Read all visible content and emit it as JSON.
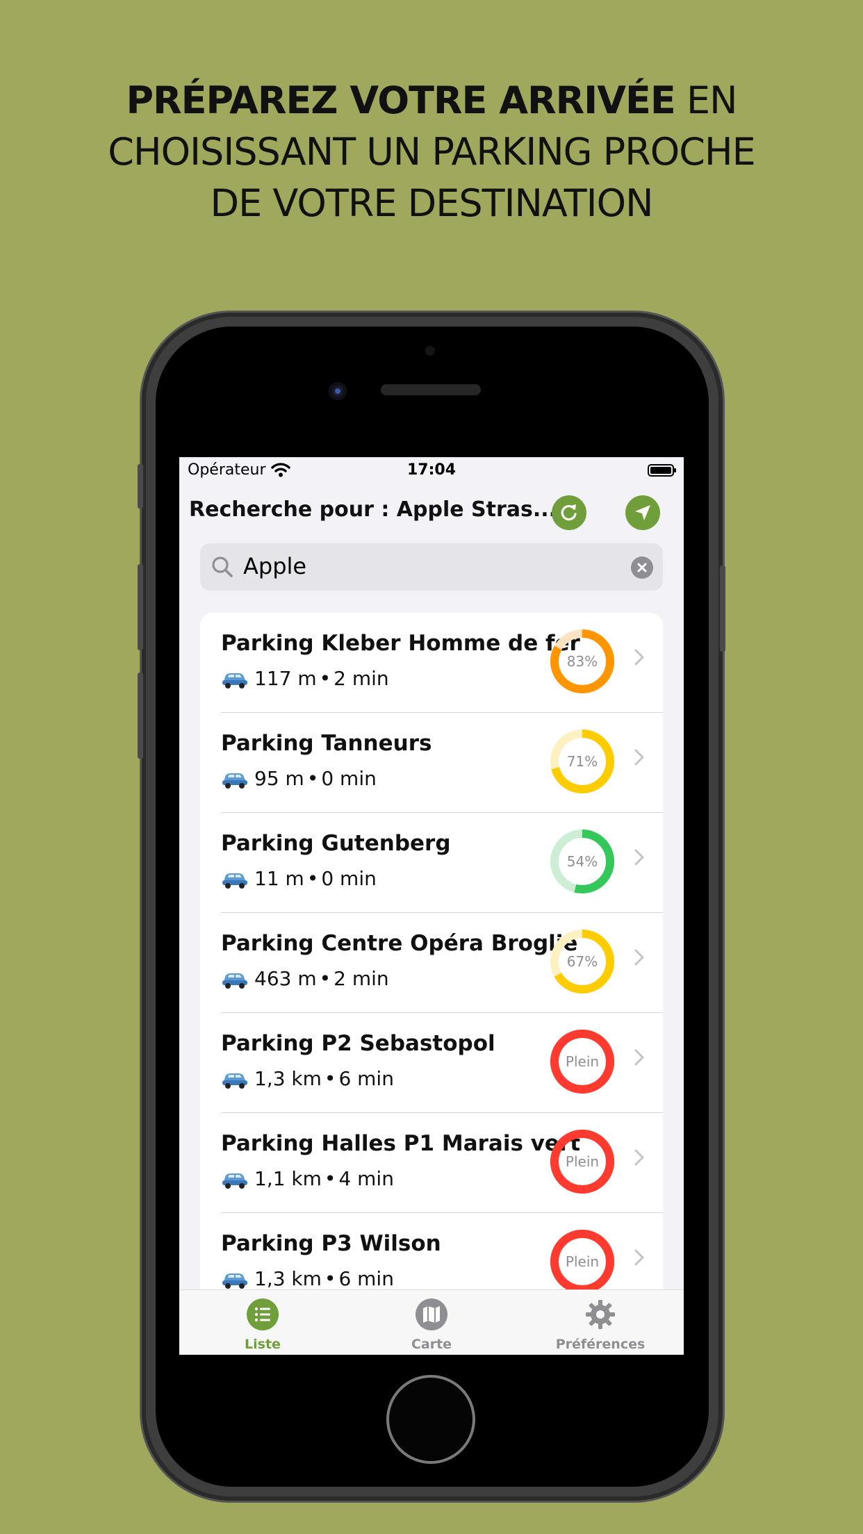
{
  "headline": {
    "bold": "PRÉPAREZ VOTRE ARRIVÉE",
    "line1_rest": " EN",
    "line2": "CHOISISSANT UN PARKING PROCHE",
    "line3": "DE VOTRE DESTINATION"
  },
  "status_bar": {
    "operator": "Opérateur",
    "time": "17:04"
  },
  "nav": {
    "title": "Recherche pour : Apple Stras...",
    "refresh_icon": "refresh-icon",
    "locate_icon": "location-arrow-icon",
    "accent": "#6f9e3a"
  },
  "search": {
    "value": "Apple"
  },
  "parkings": [
    {
      "name": "Parking Kleber Homme de fer",
      "distance": "117 m",
      "time": "2 min",
      "label": "83%",
      "fill": 0.83,
      "color": "#ff9500",
      "track": "#fde3c2"
    },
    {
      "name": "Parking Tanneurs",
      "distance": "95 m",
      "time": "0 min",
      "label": "71%",
      "fill": 0.71,
      "color": "#ffcc00",
      "track": "#fdf1c2"
    },
    {
      "name": "Parking Gutenberg",
      "distance": "11 m",
      "time": "0 min",
      "label": "54%",
      "fill": 0.54,
      "color": "#34c759",
      "track": "#cdeed5"
    },
    {
      "name": "Parking Centre Opéra Broglie",
      "distance": "463 m",
      "time": "2 min",
      "label": "67%",
      "fill": 0.67,
      "color": "#ffcc00",
      "track": "#fdf1c2"
    },
    {
      "name": "Parking P2 Sebastopol",
      "distance": "1,3 km",
      "time": "6 min",
      "label": "Plein",
      "fill": 1.0,
      "color": "#ff3b30",
      "track": "#ff3b30"
    },
    {
      "name": "Parking Halles P1 Marais vert",
      "distance": "1,1 km",
      "time": "4 min",
      "label": "Plein",
      "fill": 1.0,
      "color": "#ff3b30",
      "track": "#ff3b30"
    },
    {
      "name": "Parking P3 Wilson",
      "distance": "1,3 km",
      "time": "6 min",
      "label": "Plein",
      "fill": 1.0,
      "color": "#ff3b30",
      "track": "#ff3b30"
    }
  ],
  "tabs": [
    {
      "label": "Liste",
      "icon": "list-icon",
      "active": true
    },
    {
      "label": "Carte",
      "icon": "map-icon",
      "active": false
    },
    {
      "label": "Préférences",
      "icon": "gear-icon",
      "active": false
    }
  ]
}
